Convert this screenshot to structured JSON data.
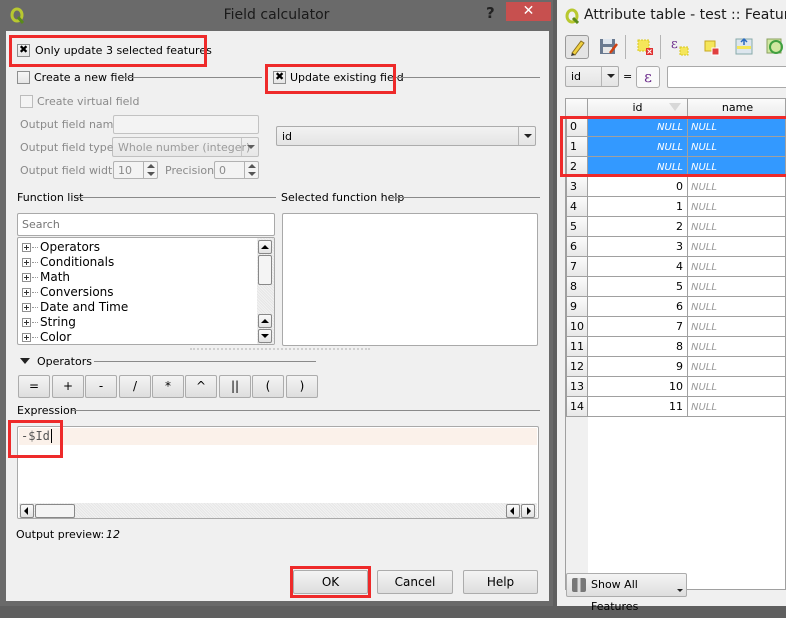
{
  "field_calculator": {
    "title": "Field calculator",
    "help_glyph": "?",
    "close_glyph": "✕",
    "only_update_selected": {
      "label": "Only update 3 selected features",
      "checked": true
    },
    "create_new_field": {
      "label": "Create a new field",
      "checked": false
    },
    "update_existing_field": {
      "label": "Update existing field",
      "checked": true
    },
    "create_virtual_field": {
      "label": "Create virtual field",
      "checked": false
    },
    "output_field_name": {
      "label": "Output field name",
      "value": ""
    },
    "output_field_type": {
      "label": "Output field type",
      "value": "Whole number (integer)"
    },
    "output_field_width": {
      "label": "Output field width",
      "value": "10"
    },
    "precision": {
      "label": "Precision",
      "value": "0"
    },
    "existing_field_select": {
      "value": "id"
    },
    "function_list": {
      "label": "Function list",
      "search_placeholder": "Search",
      "items": [
        "Operators",
        "Conditionals",
        "Math",
        "Conversions",
        "Date and Time",
        "String",
        "Color"
      ]
    },
    "selected_function_help_label": "Selected function help",
    "operators": {
      "label": "Operators",
      "buttons": [
        "=",
        "+",
        "-",
        "/",
        "*",
        "^",
        "||",
        "(",
        ")"
      ]
    },
    "expression": {
      "label": "Expression",
      "value": "-$Id"
    },
    "output_preview": {
      "label": "Output preview:",
      "value": "12"
    },
    "buttons": {
      "ok": "OK",
      "cancel": "Cancel",
      "help": "Help"
    }
  },
  "attribute_table": {
    "title": "Attribute table - test :: Features",
    "filter_field": "id",
    "filter_equals": "=",
    "expression_glyph": "ε",
    "filter_value": "",
    "toolbar_icons": [
      "toggle-editing-icon",
      "save-edits-icon",
      "deselect-all-icon",
      "select-by-expression-icon",
      "invert-selection-icon",
      "move-selection-to-top-icon",
      "pan-to-selection-icon"
    ],
    "columns": [
      "id",
      "name"
    ],
    "rows": [
      {
        "row": "0",
        "id": "NULL",
        "name": "NULL",
        "selected": true
      },
      {
        "row": "1",
        "id": "NULL",
        "name": "NULL",
        "selected": true
      },
      {
        "row": "2",
        "id": "NULL",
        "name": "NULL",
        "selected": true
      },
      {
        "row": "3",
        "id": "0",
        "name": "NULL",
        "selected": false
      },
      {
        "row": "4",
        "id": "1",
        "name": "NULL",
        "selected": false
      },
      {
        "row": "5",
        "id": "2",
        "name": "NULL",
        "selected": false
      },
      {
        "row": "6",
        "id": "3",
        "name": "NULL",
        "selected": false
      },
      {
        "row": "7",
        "id": "4",
        "name": "NULL",
        "selected": false
      },
      {
        "row": "8",
        "id": "5",
        "name": "NULL",
        "selected": false
      },
      {
        "row": "9",
        "id": "6",
        "name": "NULL",
        "selected": false
      },
      {
        "row": "10",
        "id": "7",
        "name": "NULL",
        "selected": false
      },
      {
        "row": "11",
        "id": "8",
        "name": "NULL",
        "selected": false
      },
      {
        "row": "12",
        "id": "9",
        "name": "NULL",
        "selected": false
      },
      {
        "row": "13",
        "id": "10",
        "name": "NULL",
        "selected": false
      },
      {
        "row": "14",
        "id": "11",
        "name": "NULL",
        "selected": false
      }
    ],
    "show_all_features": "Show All Features"
  },
  "colors": {
    "selection": "#3399ff",
    "highlight_box": "#ee2a2a",
    "close_button": "#c7504f"
  }
}
